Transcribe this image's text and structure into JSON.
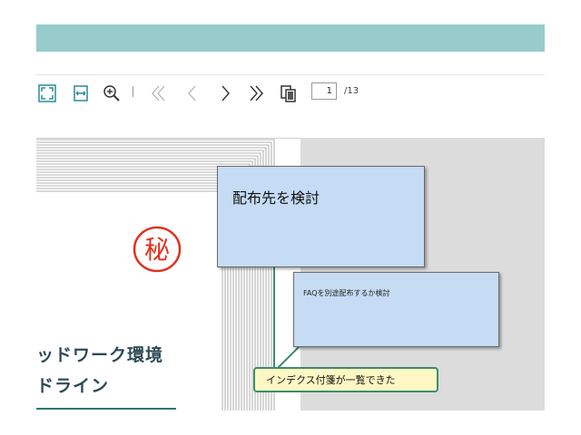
{
  "toolbar": {
    "icons": [
      "fit-page-icon",
      "fit-width-icon",
      "zoom-in-icon",
      "first-page-icon",
      "prev-page-icon",
      "next-page-icon",
      "last-page-icon",
      "page-thumbnails-icon"
    ],
    "page_current": "1",
    "page_total": "/13"
  },
  "document": {
    "title_line1": "ッドワーク環境",
    "title_line2": "ドライン",
    "stamp_char": "秘",
    "stamp_color": "#e0301e",
    "rule_color": "#2a7a6a"
  },
  "notes": [
    {
      "text": "配布先を検討",
      "color": "#c5dcf4"
    },
    {
      "text": "FAQを別途配布するか検討",
      "color": "#c5dcf4"
    }
  ],
  "callout": {
    "text": "インデクス付箋が一覧できた",
    "border_color": "#3c8d6b",
    "fill_color": "#fdf7c4"
  },
  "colors": {
    "title_bar": "#97cbcc",
    "viewer_gray": "#dcdcdc"
  }
}
